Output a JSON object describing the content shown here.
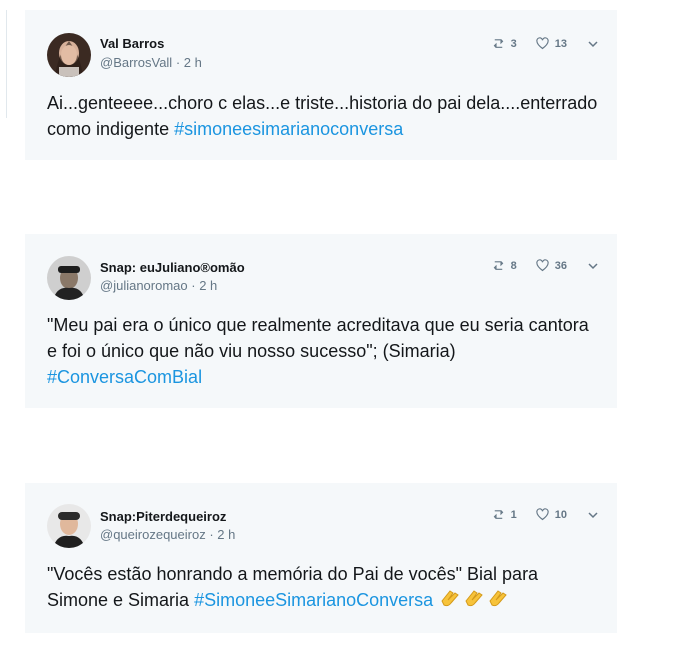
{
  "tweets": [
    {
      "name": "Val Barros",
      "handle": "@BarrosVall",
      "time": "2 h",
      "retweets": "3",
      "likes": "13",
      "text_before": "Ai...genteeee...choro c elas...e triste...historia do pai dela....enterrado como indigente ",
      "hashtag": "#simoneesimarianoconversa",
      "text_after": ""
    },
    {
      "name": "Snap: euJuliano®omão",
      "handle": "@julianoromao",
      "time": "2 h",
      "retweets": "8",
      "likes": "36",
      "text_before": "\"Meu pai era o único que realmente acreditava que eu seria cantora e foi o único que não viu nosso sucesso\"; (Simaria) ",
      "hashtag": "#ConversaComBial",
      "text_after": ""
    },
    {
      "name": "Snap:Piterdequeiroz",
      "handle": "@queirozequeiroz",
      "time": "2 h",
      "retweets": "1",
      "likes": "10",
      "text_before": "\"Vocês estão honrando a memória do Pai de vocês\" Bial para Simone e Simaria ",
      "hashtag": "#SimoneeSimarianoConversa",
      "text_after": "",
      "emoji": "clapping-hands x3"
    }
  ],
  "separator": " · ",
  "icons": {
    "retweet": "retweet-icon",
    "like": "heart-icon",
    "more": "chevron-down-icon",
    "emoji": "clapping-hands-icon"
  },
  "colors": {
    "card_bg": "#f5f8fa",
    "hashtag": "#1b95e0",
    "meta": "#657786",
    "text": "#14171a"
  }
}
